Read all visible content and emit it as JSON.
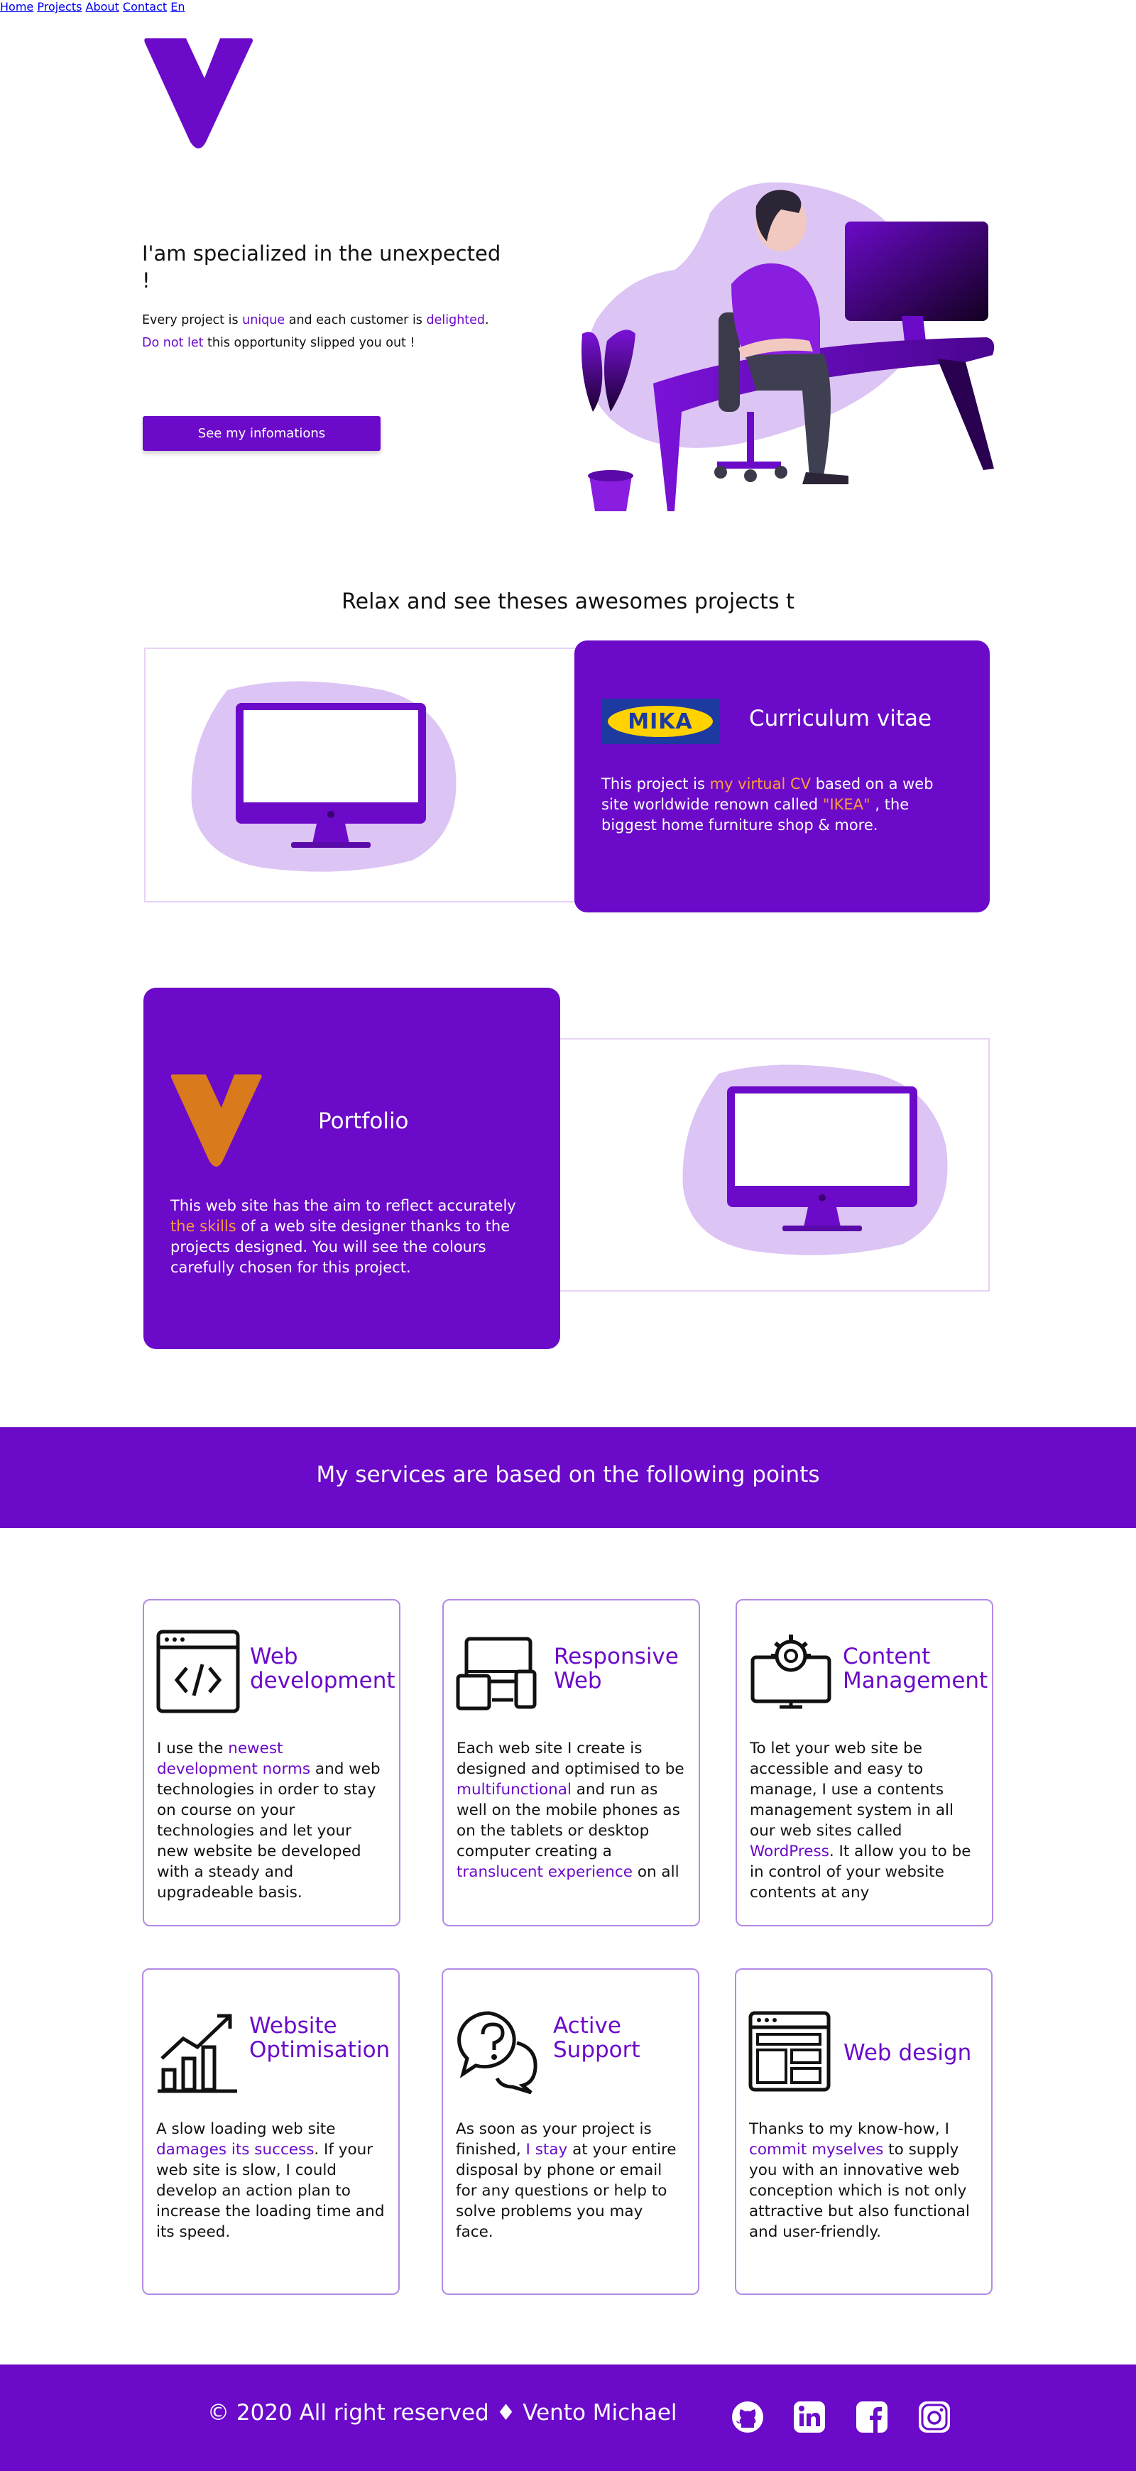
{
  "header": {
    "logo_name": "V-logo",
    "nav": [
      {
        "label": "Home",
        "active": true
      },
      {
        "label": "Projects"
      },
      {
        "label": "About"
      },
      {
        "label": "Contact"
      },
      {
        "label": "En"
      }
    ]
  },
  "hero": {
    "title": "I'am specialized in the unexpected !",
    "text_parts": {
      "p1": "Every project is ",
      "p2": "unique",
      "p3": " and each customer is ",
      "p4": "delighted",
      "p5": ".",
      "p6": "Do not let",
      "p7": " this opportunity slipped you out !"
    },
    "button": "See my infomations"
  },
  "projects": {
    "title": "Relax and see theses awesomes projects t",
    "cv": {
      "badge": "MIKA",
      "title": "Curriculum vitae",
      "t1": "This project is ",
      "t2": "my virtual CV",
      "t3": "  based on a web site worldwide renown called ",
      "t4": "\"IKEA\"",
      "t5": " , the biggest home furniture shop & more."
    },
    "portfolio": {
      "title": "Portfolio",
      "t1": "This web site has the aim to reflect accurately ",
      "t2": "the skills",
      "t3": " of a web site designer thanks to the projects designed. You will see the colours carefully chosen for this project."
    }
  },
  "services": {
    "title": "My services are based on the following points",
    "items": [
      {
        "icon": "code-window-icon",
        "title": "Web development",
        "t1": "I use the ",
        "t2": "newest development norms",
        "t3": " and web technologies in order to stay on course on your technologies and let your new website be developed with a steady and upgradeable basis."
      },
      {
        "icon": "devices-icon",
        "title": "Responsive Web",
        "t1": "Each web site I create is designed and optimised to be ",
        "t2": "multifunctional",
        "t3": " and run as well on the mobile phones as on the tablets or desktop computer creating a ",
        "t4": "translucent experience",
        "t5": " on all"
      },
      {
        "icon": "monitor-gear-icon",
        "title": "Content Management",
        "t1": "To let your web site be accessible and easy to manage, I use a contents management system in all our web sites called ",
        "t2": "WordPress",
        "t3": ". It allow you to be in control of your website contents at any"
      },
      {
        "icon": "growth-chart-icon",
        "title": "Website Optimisation",
        "t1": "A slow loading web site ",
        "t2": "damages its success",
        "t3": ". If your web site is slow, I could develop an action plan to increase the loading time and its speed."
      },
      {
        "icon": "chat-question-icon",
        "title": "Active Support",
        "t1": "As soon as your project is finished, ",
        "t2": "I stay",
        "t3": " at your entire disposal by phone or email for any questions or help to solve problems you may face."
      },
      {
        "icon": "layout-window-icon",
        "title": "Web design",
        "t1": "Thanks to my know-how, I ",
        "t2": "commit myselves",
        "t3": " to supply you with an innovative web conception which is not only attractive but also functional and user-friendly."
      }
    ]
  },
  "footer": {
    "text": "© 2020 All right reserved ♦ Vento Michael",
    "social": [
      "github-icon",
      "linkedin-icon",
      "facebook-icon",
      "instagram-icon"
    ]
  },
  "colors": {
    "accent": "#6b0ac9",
    "highlight": "#ff9a3c",
    "light": "#dcc4f4"
  }
}
